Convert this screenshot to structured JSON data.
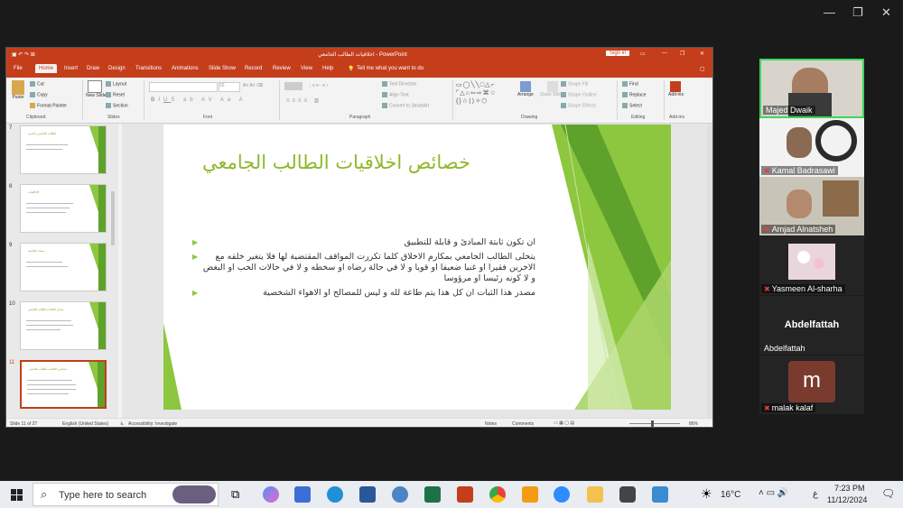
{
  "zoom_window": {
    "minimize": "—",
    "restore": "❐",
    "close": "✕"
  },
  "powerpoint": {
    "title": "اخلاقيات الطالب الجامعي  -  PowerPoint",
    "sign_in": "Sign in",
    "tabs": [
      "File",
      "Home",
      "Insert",
      "Draw",
      "Design",
      "Transitions",
      "Animations",
      "Slide Show",
      "Record",
      "Review",
      "View",
      "Help"
    ],
    "tell_me": "Tell me what you want to do",
    "ribbon": {
      "clipboard": {
        "paste": "Paste",
        "cut": "Cut",
        "copy": "Copy",
        "format_painter": "Format Painter",
        "label": "Clipboard"
      },
      "slides": {
        "new_slide": "New Slide",
        "layout": "Layout",
        "reset": "Reset",
        "section": "Section",
        "label": "Slides"
      },
      "font": {
        "label": "Font",
        "size": "16"
      },
      "paragraph": {
        "label": "Paragraph",
        "text_direction": "Text Direction",
        "align_text": "Align Text",
        "convert_smartart": "Convert to SmartArt"
      },
      "drawing": {
        "label": "Drawing",
        "arrange": "Arrange",
        "quick_styles": "Quick Styles",
        "shape_fill": "Shape Fill",
        "shape_outline": "Shape Outline",
        "shape_effects": "Shape Effects"
      },
      "editing": {
        "label": "Editing",
        "find": "Find",
        "replace": "Replace",
        "select": "Select"
      },
      "addins": {
        "label": "Add-ins",
        "add_ins": "Add-ins"
      }
    },
    "thumbnails": [
      {
        "num": "7",
        "title": "الطالب الجامعي و الحرية"
      },
      {
        "num": "8",
        "title": "الاخلاقيات"
      },
      {
        "num": "9",
        "title": "سمات الجامعة"
      },
      {
        "num": "10",
        "title": "مبادئ اخلاقيات الطالب الجامعي"
      },
      {
        "num": "11",
        "title": "خصائص اخلاقيات الطالب الجامعي"
      }
    ],
    "slide": {
      "title": "خصائص اخلاقيات الطالب الجامعي",
      "bullets": [
        "ان تكون ثابتة المبادئ و قابلة للتطبيق",
        "يتحلى الطالب الجامعي بمكارم الاخلاق كلما تكررت المواقف المقتضية لها فلا يتغير خلقه مع الاخرين فقيرا او غنيا ضعيفا او قويا و لا في حالة رضاه او سخطه و لا في حالات الحب او البغض و لا كونه رئيسا او مرؤوسا",
        "مصدر هذا الثبات ان كل هذا يتم طاعة لله و ليس للمصالح او الاهواء الشخصية"
      ]
    },
    "status": {
      "slide_info": "Slide 11 of 27",
      "language": "English (United States)",
      "accessibility": "Accessibility: Investigate",
      "notes": "Notes",
      "comments": "Comments",
      "zoom": "86%"
    }
  },
  "participants": [
    {
      "name": "Majed Dwaik"
    },
    {
      "name": "Kamal Badrasawi"
    },
    {
      "name": "Amjad Alnatsheh"
    },
    {
      "name": "Yasmeen Al-sharha"
    },
    {
      "name": "Abdelfattah",
      "display": "Abdelfattah"
    },
    {
      "name": "malak kalaf",
      "avatar_letter": "m"
    }
  ],
  "taskbar": {
    "search_placeholder": "Type here to search",
    "weather": "16°C",
    "time": "7:23 PM",
    "date": "11/12/2024",
    "lang": "ع"
  },
  "colors": {
    "pp_accent": "#c43e1c",
    "slide_green": "#8dc63f",
    "slide_title": "#8fb82c",
    "active_speaker": "#3bd85a",
    "avatar_bg": "#7a3b2e"
  }
}
